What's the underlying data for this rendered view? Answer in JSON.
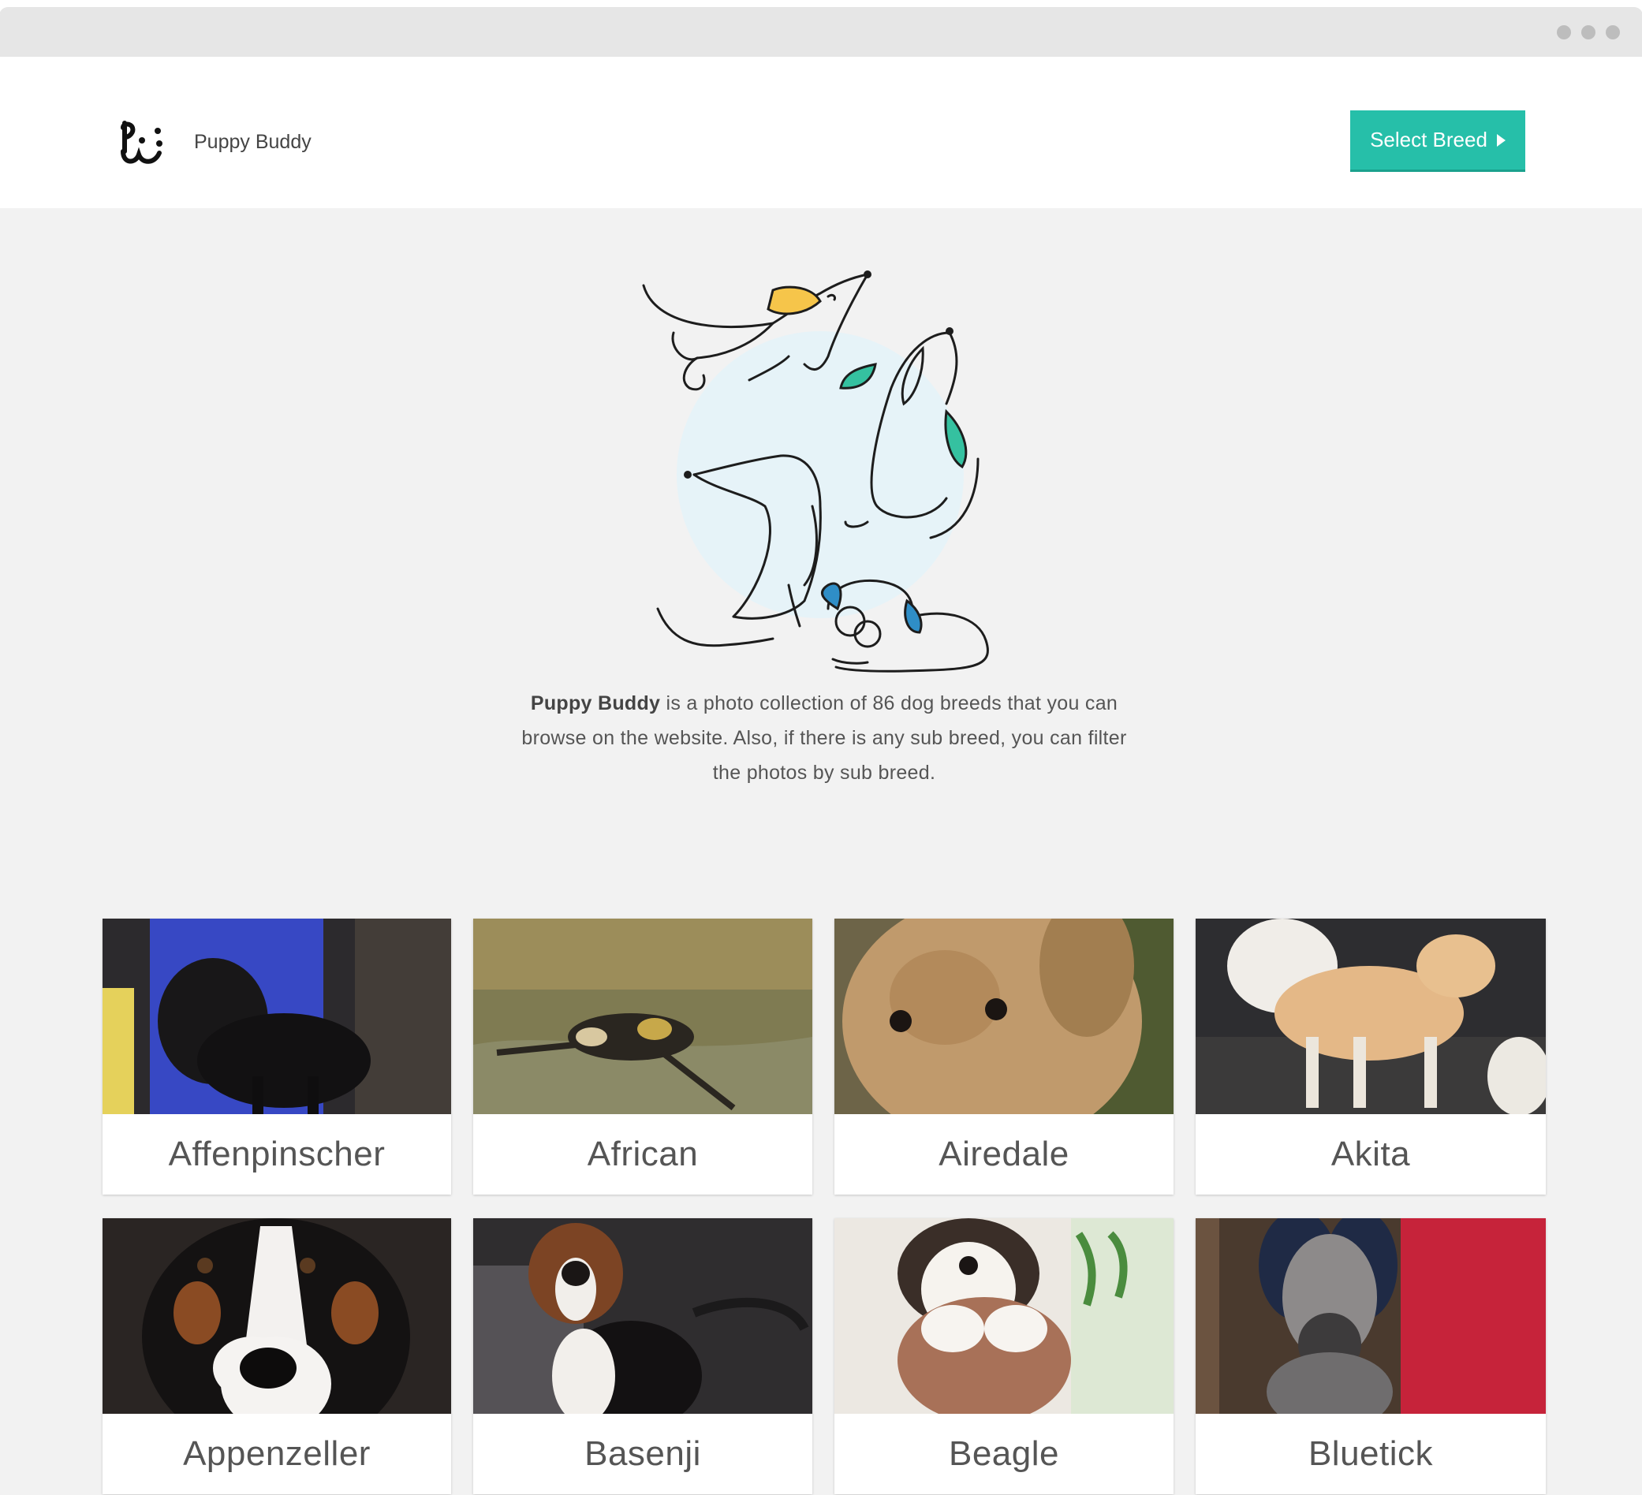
{
  "window": {
    "controls": [
      "dot",
      "dot",
      "dot"
    ]
  },
  "header": {
    "brand": "Puppy Buddy",
    "select_breed_label": "Select Breed",
    "logo_icon": "paw-face-logo-icon",
    "button_icon": "triangle-right-icon"
  },
  "hero": {
    "illustration": "dogs-illustration",
    "intro_bold": "Puppy Buddy",
    "intro_rest": " is a photo collection of 86 dog breeds that you can browse on the website. Also, if there is any sub breed, you can filter the photos by sub breed."
  },
  "colors": {
    "accent": "#26bfa9",
    "background": "#f2f2f2",
    "card": "#ffffff",
    "text": "#555555"
  },
  "breeds": [
    {
      "name": "Affenpinscher"
    },
    {
      "name": "African"
    },
    {
      "name": "Airedale"
    },
    {
      "name": "Akita"
    },
    {
      "name": "Appenzeller"
    },
    {
      "name": "Basenji"
    },
    {
      "name": "Beagle"
    },
    {
      "name": "Bluetick"
    }
  ]
}
